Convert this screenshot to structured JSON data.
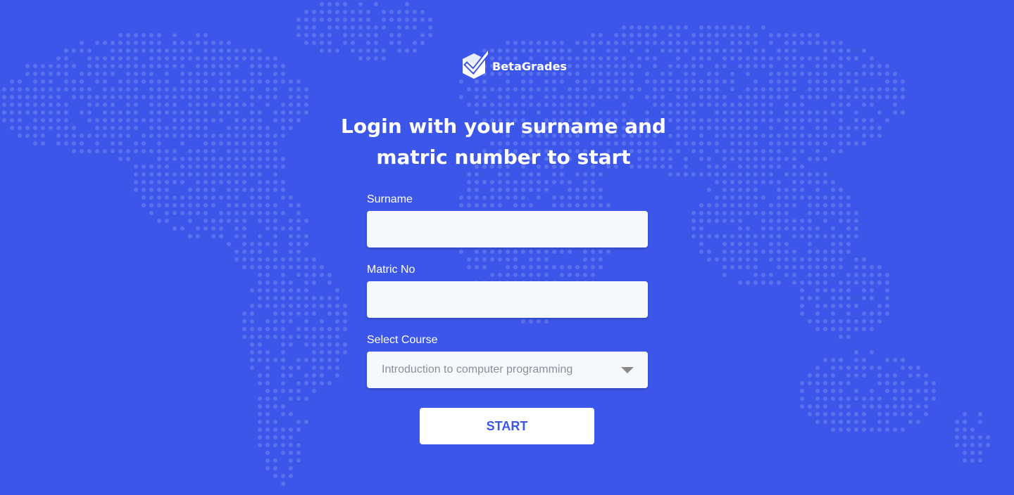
{
  "brand": {
    "name": "BetaGrades",
    "logo_icon": "checkmark-cube-icon"
  },
  "heading": {
    "line1": "Login with your surname and",
    "line2": "matric number to start"
  },
  "form": {
    "surname_label": "Surname",
    "surname_value": "",
    "matric_label": "Matric No",
    "matric_value": "",
    "course_label": "Select Course",
    "course_selected": "Introduction to computer programming",
    "course_caret_icon": "caret-down-icon",
    "start_label": "START"
  },
  "colors": {
    "background": "#3d56ea",
    "map_dots": "#5a71ef",
    "input_background": "#f5f9fc",
    "button_text": "#3d56ea"
  }
}
